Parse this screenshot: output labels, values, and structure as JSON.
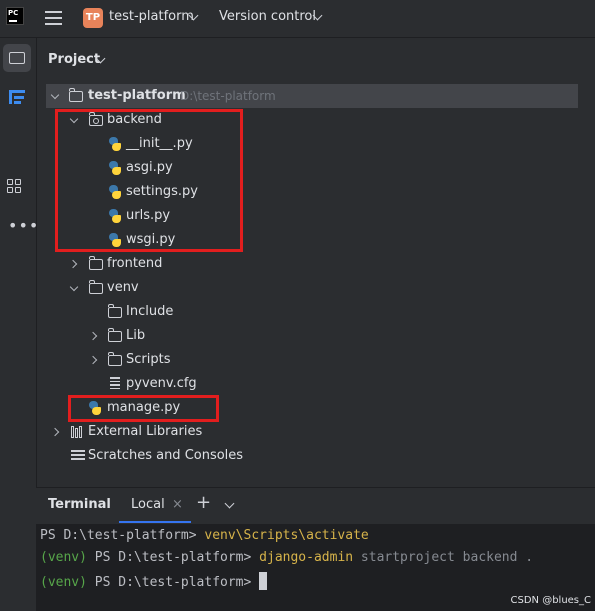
{
  "titlebar": {
    "logo_text": "PC",
    "project_badge": "TP",
    "project_name": "test-platform",
    "vcs_label": "Version control"
  },
  "panel": {
    "title": "Project"
  },
  "tree": {
    "root": {
      "name": "test-platform",
      "path": "D:\\test-platform"
    },
    "backend": "backend",
    "init_py": "__init__.py",
    "asgi_py": "asgi.py",
    "settings_py": "settings.py",
    "urls_py": "urls.py",
    "wsgi_py": "wsgi.py",
    "frontend": "frontend",
    "venv": "venv",
    "include": "Include",
    "lib": "Lib",
    "scripts": "Scripts",
    "pyvenv": "pyvenv.cfg",
    "manage_py": "manage.py",
    "external_libs": "External Libraries",
    "scratches": "Scratches and Consoles"
  },
  "terminal": {
    "title": "Terminal",
    "tab_label": "Local",
    "close_glyph": "×",
    "plus_glyph": "+",
    "line1": {
      "prompt": "PS D:\\test-platform> ",
      "cmd": "venv\\Scripts\\activate"
    },
    "line2": {
      "venv": "(venv) ",
      "prompt": "PS D:\\test-platform> ",
      "cmd": "django-admin",
      "args": " startproject backend ."
    },
    "line3": {
      "venv": "(venv) ",
      "prompt": "PS D:\\test-platform> "
    }
  },
  "watermark": "CSDN @blues_C",
  "colors": {
    "highlight_box": "#e21e1e",
    "accent": "#3574f0",
    "badge": "#e8835a"
  },
  "icons": {
    "main_menu": "hamburger-icon",
    "project_tool": "folder-icon",
    "structure_tool": "structure-icon",
    "plugins_tool": "plugins-icon",
    "more_tools": "more-icon"
  }
}
